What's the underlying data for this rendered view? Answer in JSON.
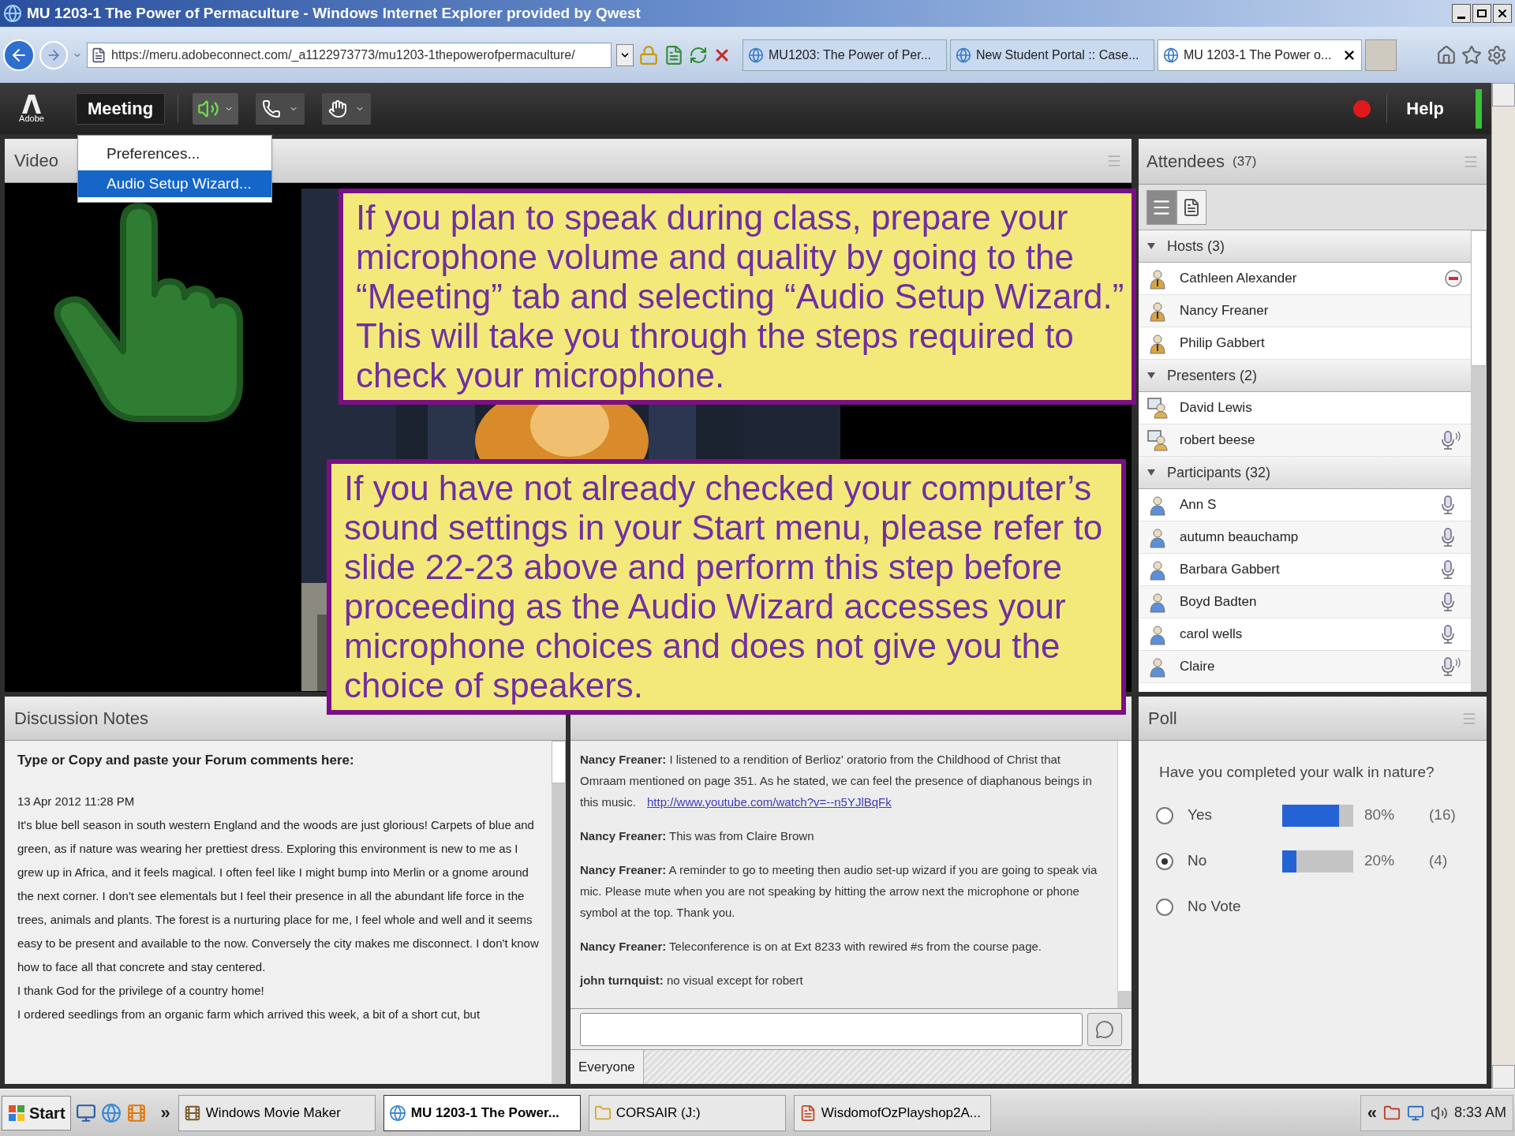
{
  "window": {
    "title": "MU 1203-1 The Power of Permaculture - Windows Internet Explorer provided by Qwest"
  },
  "browser": {
    "address": "https://meru.adobeconnect.com/_a1122973773/mu1203-1thepowerofpermaculture/",
    "tabs": [
      {
        "label": "MU1203: The Power of Per...",
        "selected": false
      },
      {
        "label": "New Student Portal :: Case...",
        "selected": false
      },
      {
        "label": "MU 1203-1 The Power o...",
        "selected": true
      }
    ]
  },
  "toolbar": {
    "logo": "Adobe",
    "menu": "Meeting",
    "help": "Help"
  },
  "meeting_menu": [
    {
      "label": "Preferences...",
      "selected": false
    },
    {
      "label": "Audio Setup Wizard...",
      "selected": true
    }
  ],
  "video": {
    "title": "Video"
  },
  "callouts": [
    "If you plan to speak during class, prepare your microphone volume and quality by going to the “Meeting” tab and selecting “Audio Setup Wizard.” This will take you through the steps required to check your microphone.",
    "If you have not already checked your computer’s sound settings in your Start menu, please refer to slide 22-23 above and perform this step before proceeding as the Audio Wizard accesses your microphone choices and does not give you the choice of speakers."
  ],
  "attendees": {
    "title": "Attendees",
    "count": "(37)",
    "views": [
      {
        "kind": "list",
        "selected": true
      },
      {
        "kind": "detail",
        "selected": false
      }
    ],
    "groups": [
      {
        "label": "Hosts (3)",
        "expanded": true,
        "children": [
          {
            "name": "Cathleen Alexander",
            "kind": "host",
            "removable": true,
            "microphone": false,
            "talking": false
          },
          {
            "name": "Nancy Freaner",
            "kind": "host",
            "removable": false,
            "microphone": false,
            "talking": false
          },
          {
            "name": "Philip Gabbert",
            "kind": "host",
            "removable": false,
            "microphone": false,
            "talking": false
          }
        ]
      },
      {
        "label": "Presenters (2)",
        "expanded": true,
        "children": [
          {
            "name": "David Lewis",
            "kind": "presenter",
            "removable": false,
            "microphone": false,
            "talking": false
          },
          {
            "name": "robert beese",
            "kind": "presenter",
            "removable": false,
            "microphone": true,
            "talking": true
          }
        ]
      },
      {
        "label": "Participants (32)",
        "expanded": true,
        "children": [
          {
            "name": "Ann S",
            "kind": "participant",
            "removable": false,
            "microphone": true,
            "talking": false
          },
          {
            "name": "autumn beauchamp",
            "kind": "participant",
            "removable": false,
            "microphone": true,
            "talking": false
          },
          {
            "name": "Barbara Gabbert",
            "kind": "participant",
            "removable": false,
            "microphone": true,
            "talking": false
          },
          {
            "name": "Boyd Badten",
            "kind": "participant",
            "removable": false,
            "microphone": true,
            "talking": false
          },
          {
            "name": "carol wells",
            "kind": "participant",
            "removable": false,
            "microphone": true,
            "talking": false
          },
          {
            "name": "Claire",
            "kind": "participant",
            "removable": false,
            "microphone": true,
            "talking": true
          }
        ]
      }
    ]
  },
  "notes": {
    "title": "Discussion Notes",
    "heading": "Type or Copy and paste your Forum comments here:",
    "paragraphs": [
      "13 Apr 2012 11:28 PM",
      "It's blue bell season in south western England and the woods are just glorious! Carpets of blue and green, as if nature was wearing her prettiest dress. Exploring this environment is new to me as I grew up in Africa, and it feels magical. I often feel like I might bump into Merlin or a gnome around the next corner. I don't see elementals but I feel their presence in all the abundant life force in the trees, animals and plants. The forest is a nurturing place for me, I feel whole and well and it seems easy to be present and available to the now. Conversely the city makes me disconnect. I don't know how to face all that concrete and stay centered.",
      "I thank God for the privilege of a country home!",
      "I ordered seedlings from an organic farm which arrived this week, a bit of a short cut, but"
    ]
  },
  "chat": {
    "messages": [
      {
        "text": "**Nancy Freaner:** I listened to a rendition of Berlioz' oratorio from the Childhood of Christ that Omraam mentioned on page 351. As he stated, we can feel the presence of diaphanous beings in this music.",
        "link": "http://www.youtube.com/watch?v=--n5YJlBqFk"
      },
      {
        "text": "**Nancy Freaner:** This was from Claire Brown"
      },
      {
        "text": "**Nancy Freaner:** A reminder to go to meeting then audio set-up wizard if you are going to speak via mic. Please mute when you are not speaking by hitting the arrow next the microphone or phone symbol at the top. Thank you."
      },
      {
        "text": "**Nancy Freaner:** Teleconference is on at Ext 8233 with rewired #s from the course page."
      },
      {
        "text": "**john turnquist:** no visual except for robert"
      }
    ],
    "tab": "Everyone"
  },
  "poll": {
    "title": "Poll",
    "question": "Have you completed your walk in nature?",
    "options": [
      {
        "label": "Yes",
        "selected": false,
        "level": 0.8,
        "percent": "80%",
        "count": "(16)"
      },
      {
        "label": "No",
        "selected": true,
        "level": 0.2,
        "percent": "20%",
        "count": "(4)"
      },
      {
        "label": "No Vote",
        "selected": false
      }
    ]
  },
  "taskbar": {
    "start": "Start",
    "more": "»",
    "tasks": [
      {
        "label": "Windows Movie Maker",
        "selected": false
      },
      {
        "label": "MU 1203-1 The Power...",
        "selected": true
      },
      {
        "label": "CORSAIR (J:)",
        "selected": false
      },
      {
        "label": "WisdomofOzPlayshop2A...",
        "selected": false
      }
    ],
    "tray_more": "«",
    "time": "8:33 AM"
  }
}
